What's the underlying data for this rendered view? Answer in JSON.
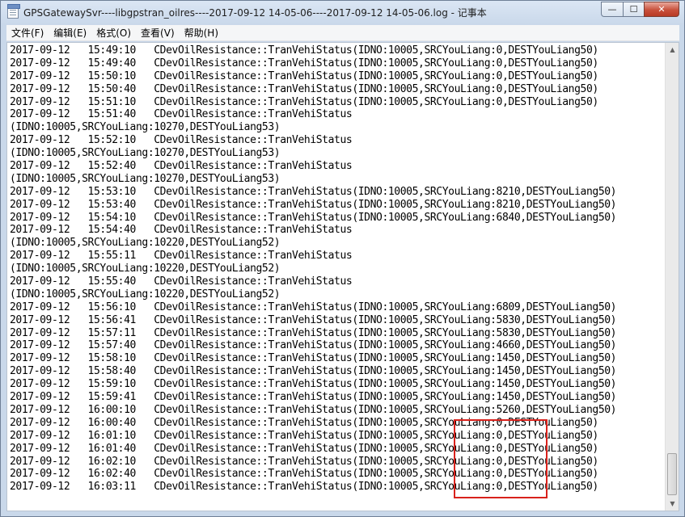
{
  "window": {
    "title": "GPSGatewaySvr----libgpstran_oilres----2017-09-12 14-05-06----2017-09-12 14-05-06.log - 记事本",
    "min_glyph": "—",
    "max_glyph": "☐",
    "close_glyph": "✕"
  },
  "menu": {
    "items": [
      "文件(F)",
      "编辑(E)",
      "格式(O)",
      "查看(V)",
      "帮助(H)"
    ]
  },
  "content": {
    "lines": [
      "2017-09-12   15:49:10   CDevOilResistance::TranVehiStatus(IDNO:10005,SRCYouLiang:0,DESTYouLiang50)",
      "2017-09-12   15:49:40   CDevOilResistance::TranVehiStatus(IDNO:10005,SRCYouLiang:0,DESTYouLiang50)",
      "2017-09-12   15:50:10   CDevOilResistance::TranVehiStatus(IDNO:10005,SRCYouLiang:0,DESTYouLiang50)",
      "2017-09-12   15:50:40   CDevOilResistance::TranVehiStatus(IDNO:10005,SRCYouLiang:0,DESTYouLiang50)",
      "2017-09-12   15:51:10   CDevOilResistance::TranVehiStatus(IDNO:10005,SRCYouLiang:0,DESTYouLiang50)",
      "2017-09-12   15:51:40   CDevOilResistance::TranVehiStatus",
      "(IDNO:10005,SRCYouLiang:10270,DESTYouLiang53)",
      "2017-09-12   15:52:10   CDevOilResistance::TranVehiStatus",
      "(IDNO:10005,SRCYouLiang:10270,DESTYouLiang53)",
      "2017-09-12   15:52:40   CDevOilResistance::TranVehiStatus",
      "(IDNO:10005,SRCYouLiang:10270,DESTYouLiang53)",
      "2017-09-12   15:53:10   CDevOilResistance::TranVehiStatus(IDNO:10005,SRCYouLiang:8210,DESTYouLiang50)",
      "2017-09-12   15:53:40   CDevOilResistance::TranVehiStatus(IDNO:10005,SRCYouLiang:8210,DESTYouLiang50)",
      "2017-09-12   15:54:10   CDevOilResistance::TranVehiStatus(IDNO:10005,SRCYouLiang:6840,DESTYouLiang50)",
      "2017-09-12   15:54:40   CDevOilResistance::TranVehiStatus",
      "(IDNO:10005,SRCYouLiang:10220,DESTYouLiang52)",
      "2017-09-12   15:55:11   CDevOilResistance::TranVehiStatus",
      "(IDNO:10005,SRCYouLiang:10220,DESTYouLiang52)",
      "2017-09-12   15:55:40   CDevOilResistance::TranVehiStatus",
      "(IDNO:10005,SRCYouLiang:10220,DESTYouLiang52)",
      "2017-09-12   15:56:10   CDevOilResistance::TranVehiStatus(IDNO:10005,SRCYouLiang:6809,DESTYouLiang50)",
      "2017-09-12   15:56:41   CDevOilResistance::TranVehiStatus(IDNO:10005,SRCYouLiang:5830,DESTYouLiang50)",
      "2017-09-12   15:57:11   CDevOilResistance::TranVehiStatus(IDNO:10005,SRCYouLiang:5830,DESTYouLiang50)",
      "2017-09-12   15:57:40   CDevOilResistance::TranVehiStatus(IDNO:10005,SRCYouLiang:4660,DESTYouLiang50)",
      "2017-09-12   15:58:10   CDevOilResistance::TranVehiStatus(IDNO:10005,SRCYouLiang:1450,DESTYouLiang50)",
      "2017-09-12   15:58:40   CDevOilResistance::TranVehiStatus(IDNO:10005,SRCYouLiang:1450,DESTYouLiang50)",
      "2017-09-12   15:59:10   CDevOilResistance::TranVehiStatus(IDNO:10005,SRCYouLiang:1450,DESTYouLiang50)",
      "2017-09-12   15:59:41   CDevOilResistance::TranVehiStatus(IDNO:10005,SRCYouLiang:1450,DESTYouLiang50)",
      "2017-09-12   16:00:10   CDevOilResistance::TranVehiStatus(IDNO:10005,SRCYouLiang:5260,DESTYouLiang50)",
      "2017-09-12   16:00:40   CDevOilResistance::TranVehiStatus(IDNO:10005,SRCYouLiang:0,DESTYouLiang50)",
      "2017-09-12   16:01:10   CDevOilResistance::TranVehiStatus(IDNO:10005,SRCYouLiang:0,DESTYouLiang50)",
      "2017-09-12   16:01:40   CDevOilResistance::TranVehiStatus(IDNO:10005,SRCYouLiang:0,DESTYouLiang50)",
      "2017-09-12   16:02:10   CDevOilResistance::TranVehiStatus(IDNO:10005,SRCYouLiang:0,DESTYouLiang50)",
      "2017-09-12   16:02:40   CDevOilResistance::TranVehiStatus(IDNO:10005,SRCYouLiang:0,DESTYouLiang50)",
      "2017-09-12   16:03:11   CDevOilResistance::TranVehiStatus(IDNO:10005,SRCYouLiang:0,DESTYouLiang50)"
    ]
  },
  "scrollbar": {
    "up_glyph": "▲",
    "down_glyph": "▼"
  },
  "colors": {
    "highlight": "#d9221c"
  }
}
